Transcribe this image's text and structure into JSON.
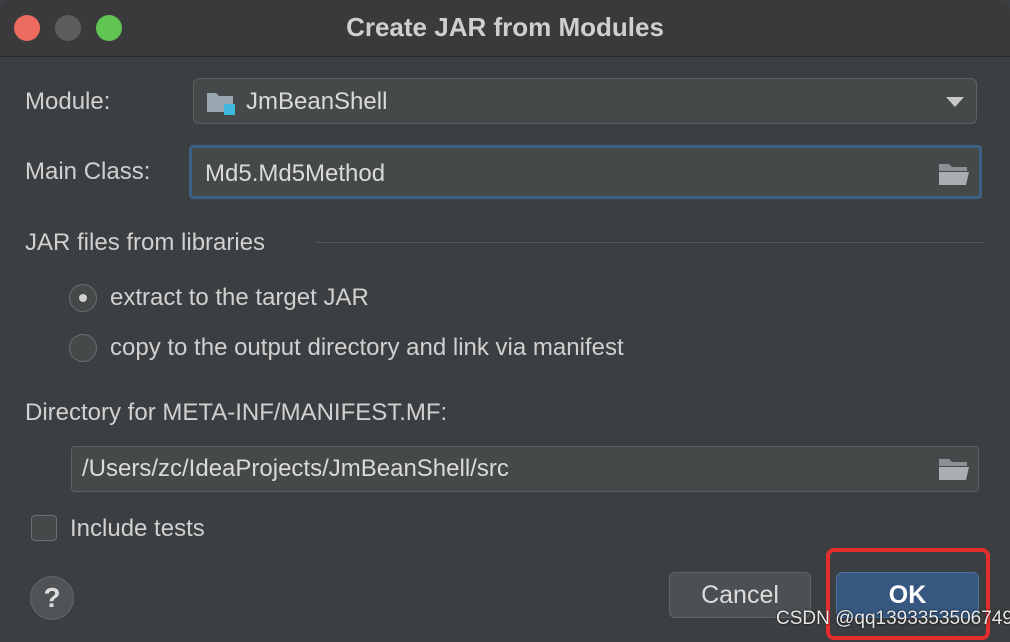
{
  "window": {
    "title": "Create JAR from Modules",
    "controls": [
      "close",
      "minimize",
      "zoom"
    ]
  },
  "module": {
    "label": "Module:",
    "value": "JmBeanShell",
    "icon": "module-folder-icon"
  },
  "main_class": {
    "label": "Main Class:",
    "value": "Md5.Md5Method",
    "icon": "folder-browse-icon"
  },
  "jar_files": {
    "section_label": "JAR files from libraries",
    "options": [
      {
        "label": "extract to the target JAR",
        "selected": true
      },
      {
        "label": "copy to the output directory and link via manifest",
        "selected": false
      }
    ]
  },
  "manifest": {
    "label": "Directory for META-INF/MANIFEST.MF:",
    "value": "/Users/zc/IdeaProjects/JmBeanShell/src",
    "icon": "folder-browse-icon"
  },
  "include_tests": {
    "label": "Include tests",
    "checked": false
  },
  "buttons": {
    "help": "?",
    "cancel": "Cancel",
    "ok": "OK"
  },
  "watermark": "CSDN @qq1393353506749",
  "colors": {
    "background": "#3c3f41",
    "focus_border": "#3d6185",
    "ok_button": "#365880",
    "highlight_box": "#e52d2d"
  }
}
